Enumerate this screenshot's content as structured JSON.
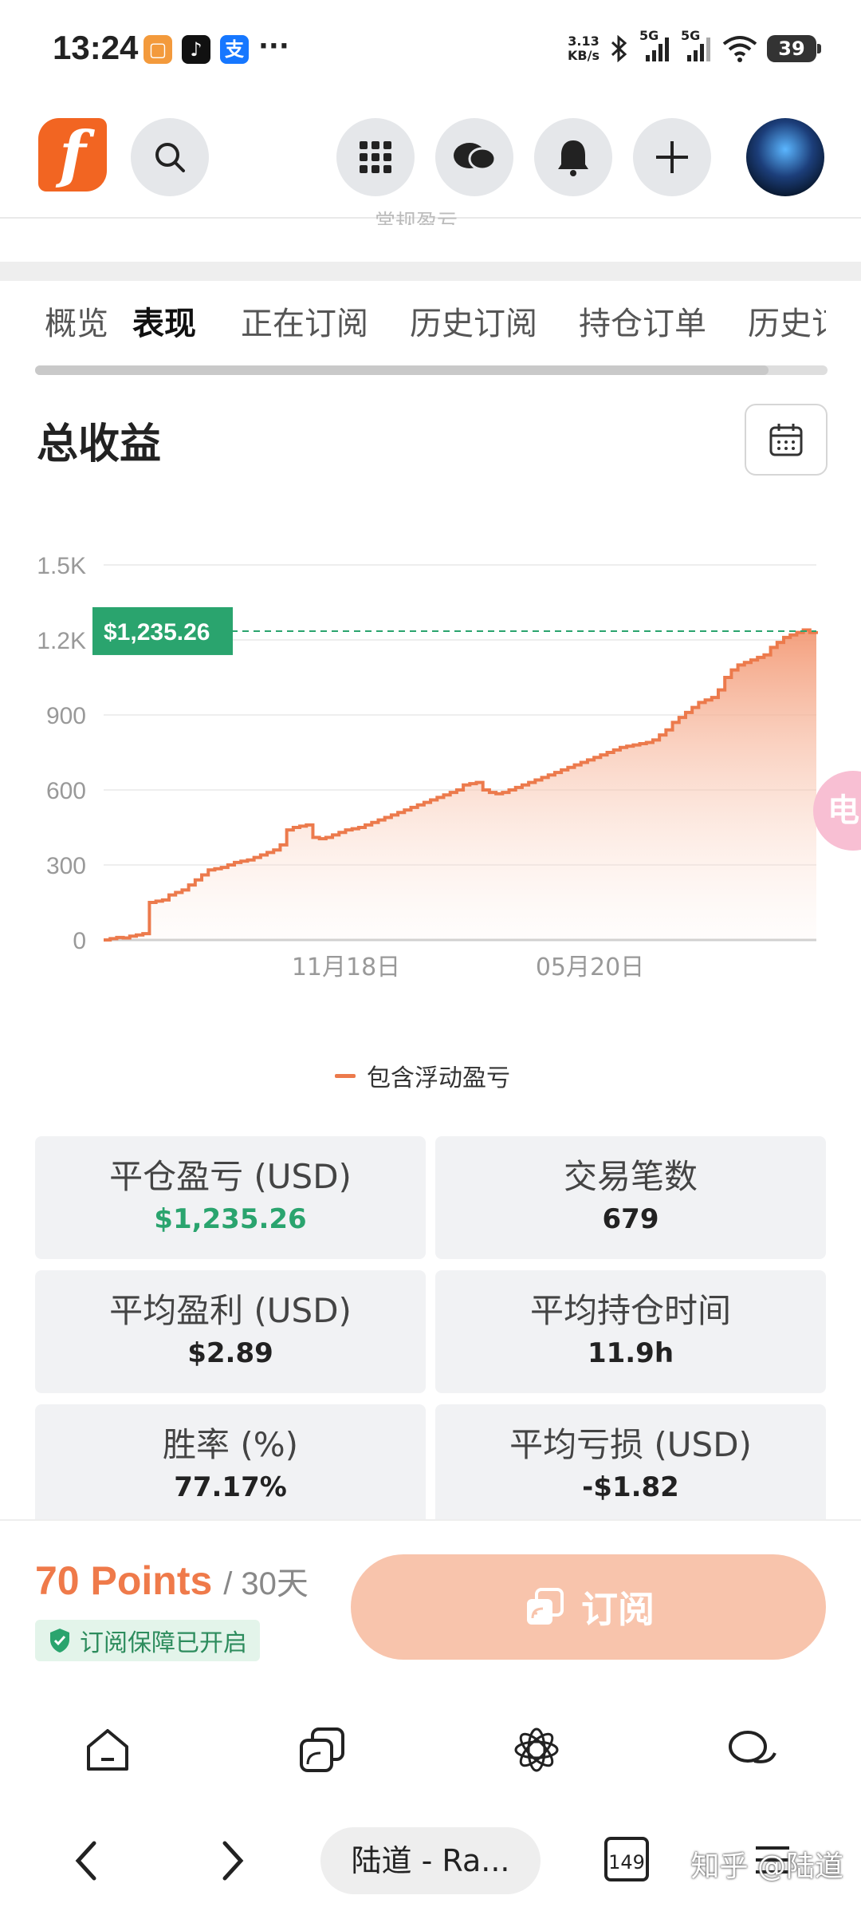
{
  "status_bar": {
    "time": "13:24",
    "network_speed": "3.13\nKB/s",
    "signal1": "5G",
    "signal2": "5G",
    "battery": "39"
  },
  "header": {
    "logo_letter": "f",
    "partial_text": "常规盈亏"
  },
  "tabs": [
    "概览",
    "表现",
    "正在订阅",
    "历史订阅",
    "持仓订单",
    "历史订"
  ],
  "active_tab_index": 1,
  "section": {
    "title": "总收益"
  },
  "chart_data": {
    "type": "area",
    "y_tick_labels": [
      "1.5K",
      "1.2K",
      "900",
      "600",
      "300",
      "0"
    ],
    "x_tick_labels": [
      "11月18日",
      "05月20日"
    ],
    "ylim": [
      0,
      1500
    ],
    "current_value_label": "$1,235.26",
    "current_value": 1235.26,
    "series": [
      {
        "name": "包含浮动盈亏",
        "color": "#ec7a4c",
        "values": [
          0,
          5,
          10,
          8,
          15,
          20,
          25,
          150,
          155,
          160,
          180,
          190,
          200,
          220,
          240,
          260,
          280,
          285,
          290,
          300,
          310,
          315,
          320,
          330,
          340,
          350,
          360,
          380,
          440,
          450,
          455,
          460,
          410,
          405,
          410,
          420,
          430,
          440,
          445,
          450,
          460,
          470,
          480,
          490,
          500,
          510,
          520,
          530,
          540,
          550,
          560,
          570,
          580,
          590,
          600,
          620,
          625,
          630,
          600,
          590,
          585,
          590,
          600,
          610,
          620,
          630,
          640,
          650,
          660,
          670,
          680,
          690,
          700,
          710,
          720,
          730,
          740,
          750,
          760,
          770,
          775,
          780,
          785,
          790,
          800,
          820,
          840,
          870,
          890,
          910,
          930,
          950,
          960,
          970,
          1000,
          1050,
          1080,
          1100,
          1110,
          1120,
          1130,
          1140,
          1170,
          1190,
          1210,
          1220,
          1230,
          1240,
          1230,
          1235
        ]
      }
    ]
  },
  "stats": [
    {
      "label": "平仓盈亏 (USD)",
      "value": "$1,235.26",
      "green": true
    },
    {
      "label": "交易笔数",
      "value": "679"
    },
    {
      "label": "平均盈利 (USD)",
      "value": "$2.89"
    },
    {
      "label": "平均持仓时间",
      "value": "11.9h"
    },
    {
      "label": "胜率 (%)",
      "value": "77.17%"
    },
    {
      "label": "平均亏损 (USD)",
      "value": "-$1.82"
    }
  ],
  "float_bubble": "电",
  "subscribe": {
    "points": "70 Points",
    "period": "/ 30天",
    "guarantee": "订阅保障已开启",
    "button": "订阅"
  },
  "browser": {
    "url": "陆道 - Ra...",
    "tab_count": "149",
    "watermark": "知乎 @陆道"
  },
  "colors": {
    "brand": "#f26522",
    "accent": "#ec7a4c",
    "green": "#2aa46e"
  }
}
